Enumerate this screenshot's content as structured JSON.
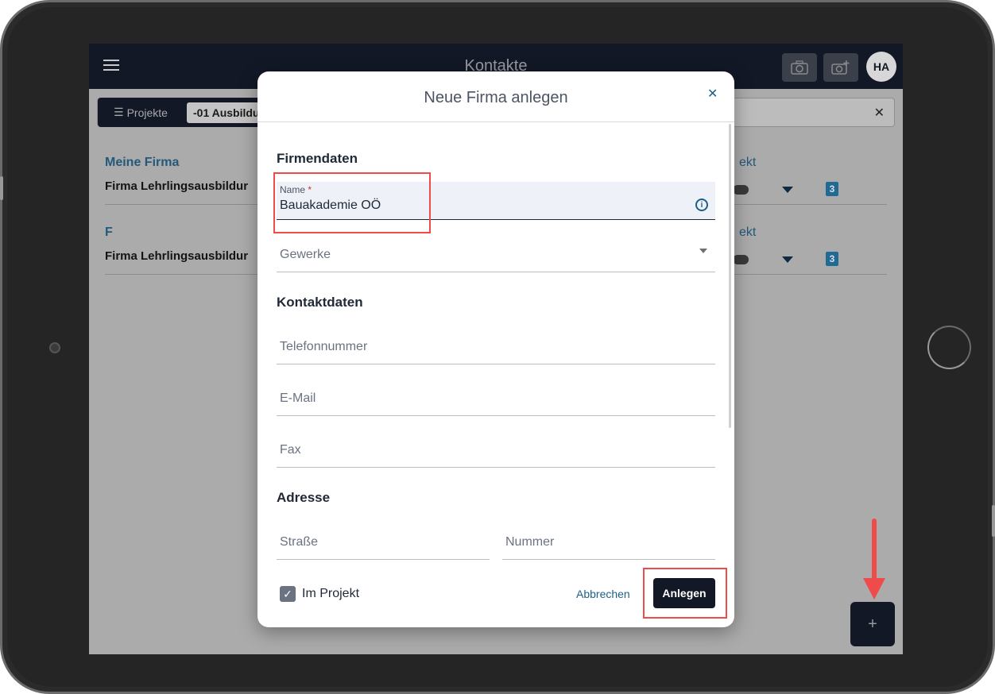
{
  "app": {
    "title": "Kontakte",
    "avatar_initials": "HA",
    "camera_icon": "camera-icon",
    "camera_plus_icon": "camera-plus-icon"
  },
  "toolbar": {
    "projects_label": "Projekte",
    "projects_icon": "list-icon",
    "project_value": "-01 Ausbildur",
    "close_symbol": "✕"
  },
  "background_list": {
    "sections": [
      {
        "label": "Meine Firma",
        "row": "Firma Lehrlingsausbildur",
        "right_label": "ekt",
        "badge": "3"
      },
      {
        "label": "F",
        "row": "Firma Lehrlingsausbildur",
        "right_label": "ekt",
        "badge": "3"
      }
    ]
  },
  "fab_symbol": "+",
  "modal": {
    "title": "Neue Firma anlegen",
    "close_symbol": "✕",
    "groups": {
      "company": "Firmendaten",
      "contact": "Kontaktdaten",
      "address": "Adresse"
    },
    "name_field": {
      "label": "Name",
      "required_mark": "*",
      "value": "Bauakademie OÖ",
      "info_symbol": "i"
    },
    "trades_placeholder": "Gewerke",
    "phone_placeholder": "Telefonnummer",
    "email_placeholder": "E-Mail",
    "fax_placeholder": "Fax",
    "street_placeholder": "Straße",
    "number_placeholder": "Nummer",
    "in_project_label": "Im Projekt",
    "in_project_checked": true,
    "check_symbol": "✓",
    "cancel_label": "Abbrechen",
    "create_label": "Anlegen"
  },
  "colors": {
    "accent": "#1f5f87",
    "dark": "#121826",
    "highlight": "#ef4b4b"
  }
}
